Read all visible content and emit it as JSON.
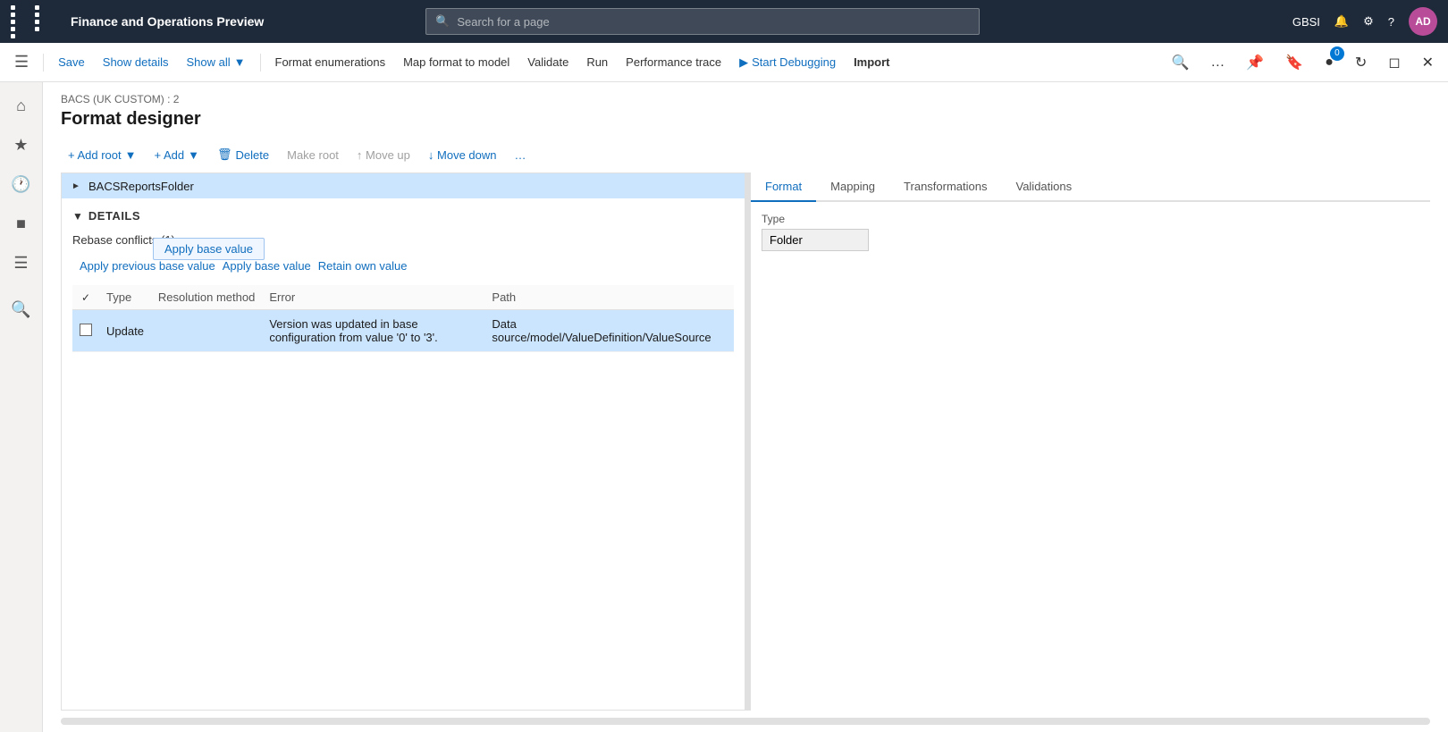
{
  "topNav": {
    "title": "Finance and Operations Preview",
    "search": {
      "placeholder": "Search for a page"
    },
    "userInitials": "AD",
    "orgCode": "GBSI",
    "notificationCount": "0"
  },
  "toolbar": {
    "saveLabel": "Save",
    "showDetailsLabel": "Show details",
    "showAllLabel": "Show all",
    "formatEnumerationsLabel": "Format enumerations",
    "mapFormatToModelLabel": "Map format to model",
    "validateLabel": "Validate",
    "runLabel": "Run",
    "performanceTraceLabel": "Performance trace",
    "startDebuggingLabel": "Start Debugging",
    "importLabel": "Import"
  },
  "pageHeader": {
    "breadcrumb": "BACS (UK CUSTOM) : 2",
    "title": "Format designer"
  },
  "actionToolbar": {
    "addRootLabel": "+ Add root",
    "addLabel": "+ Add",
    "deleteLabel": "Delete",
    "makeRootLabel": "Make root",
    "moveUpLabel": "↑ Move up",
    "moveDownLabel": "↓ Move down"
  },
  "tabs": {
    "format": "Format",
    "mapping": "Mapping",
    "transformations": "Transformations",
    "validations": "Validations"
  },
  "tree": {
    "items": [
      {
        "label": "BACSReportsFolder",
        "expanded": false
      }
    ]
  },
  "typePanel": {
    "typeLabel": "Type",
    "typeValue": "Folder"
  },
  "details": {
    "sectionTitle": "DETAILS",
    "conflictsTitle": "Rebase conflicts (1)",
    "applyPreviousBaseValue": "Apply previous base value",
    "applyBaseValue": "Apply base value",
    "retainOwnValue": "Retain own value",
    "table": {
      "columns": [
        "Resolved",
        "Type",
        "Resolution method",
        "Error",
        "Path"
      ],
      "rows": [
        {
          "resolved": false,
          "type": "Update",
          "resolutionMethod": "",
          "error": "Version was updated in base configuration from value '0' to '3'.",
          "path": "Data source/model/ValueDefinition/ValueSource"
        }
      ]
    }
  }
}
